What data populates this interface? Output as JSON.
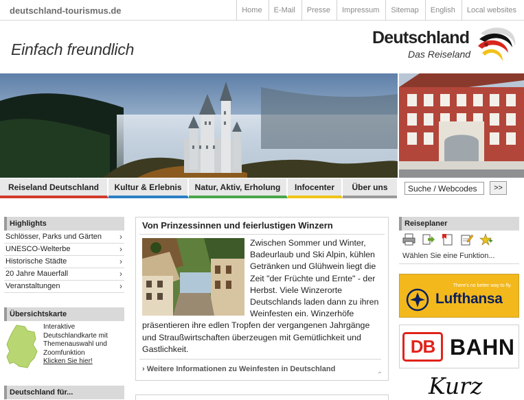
{
  "topbar": {
    "site_url": "deutschland-tourismus.de",
    "links": [
      "Home",
      "E-Mail",
      "Presse",
      "Impressum",
      "Sitemap",
      "English",
      "Local websites"
    ]
  },
  "header": {
    "slogan": "Einfach freundlich",
    "logo_title": "Deutschland",
    "logo_subtitle": "Das Reiseland"
  },
  "mainnav": {
    "tabs": [
      "Reiseland Deutschland",
      "Kultur & Erlebnis",
      "Natur, Aktiv, Erholung",
      "Infocenter",
      "Über uns"
    ],
    "colors": [
      "#d23a2c",
      "#2b7fc5",
      "#4aa64a",
      "#f0c419",
      "#9a9a9a"
    ]
  },
  "search": {
    "value": "Suche / Webcodes",
    "button": ">>"
  },
  "highlights": {
    "title": "Highlights",
    "items": [
      "Schlösser, Parks und Gärten",
      "UNESCO-Welterbe",
      "Historische Städte",
      "20 Jahre Mauerfall",
      "Veranstaltungen"
    ]
  },
  "overview_map": {
    "title": "Übersichtskarte",
    "text": "Interaktive Deutschlandkarte mit Themenauswahl und Zoomfunktion",
    "link": "Klicken Sie hier!"
  },
  "deutschland_fuer": {
    "title": "Deutschland für..."
  },
  "article": {
    "title": "Von Prinzessinnen und feierlustigen Winzern",
    "body": "Zwischen Sommer und Winter, Badeurlaub und Ski Alpin, kühlen Getränken und Glühwein liegt die Zeit \"der Früchte und Ernte\" - der Herbst. Viele Winzerorte Deutschlands laden dann zu ihren Weinfesten ein. Winzerhöfe präsentieren ihre edlen Tropfen der vergangenen Jahrgänge und Straußwirtschaften überzeugen mit Gemütlichkeit und Gastlichkeit.",
    "more_link": "Weitere Informationen zu Weinfesten in Deutschland"
  },
  "reiseplaner": {
    "title": "Reiseplaner",
    "icons": [
      "print-icon",
      "export-icon",
      "bookmark-icon",
      "notepad-icon",
      "add-star-icon"
    ],
    "hint": "Wählen Sie eine Funktion..."
  },
  "ads": {
    "lufthansa_tagline": "There's no better way to fly.",
    "lufthansa_name": "Lufthansa",
    "db_logo": "DB",
    "db_name": "BAHN",
    "kurz": "Kurz"
  }
}
